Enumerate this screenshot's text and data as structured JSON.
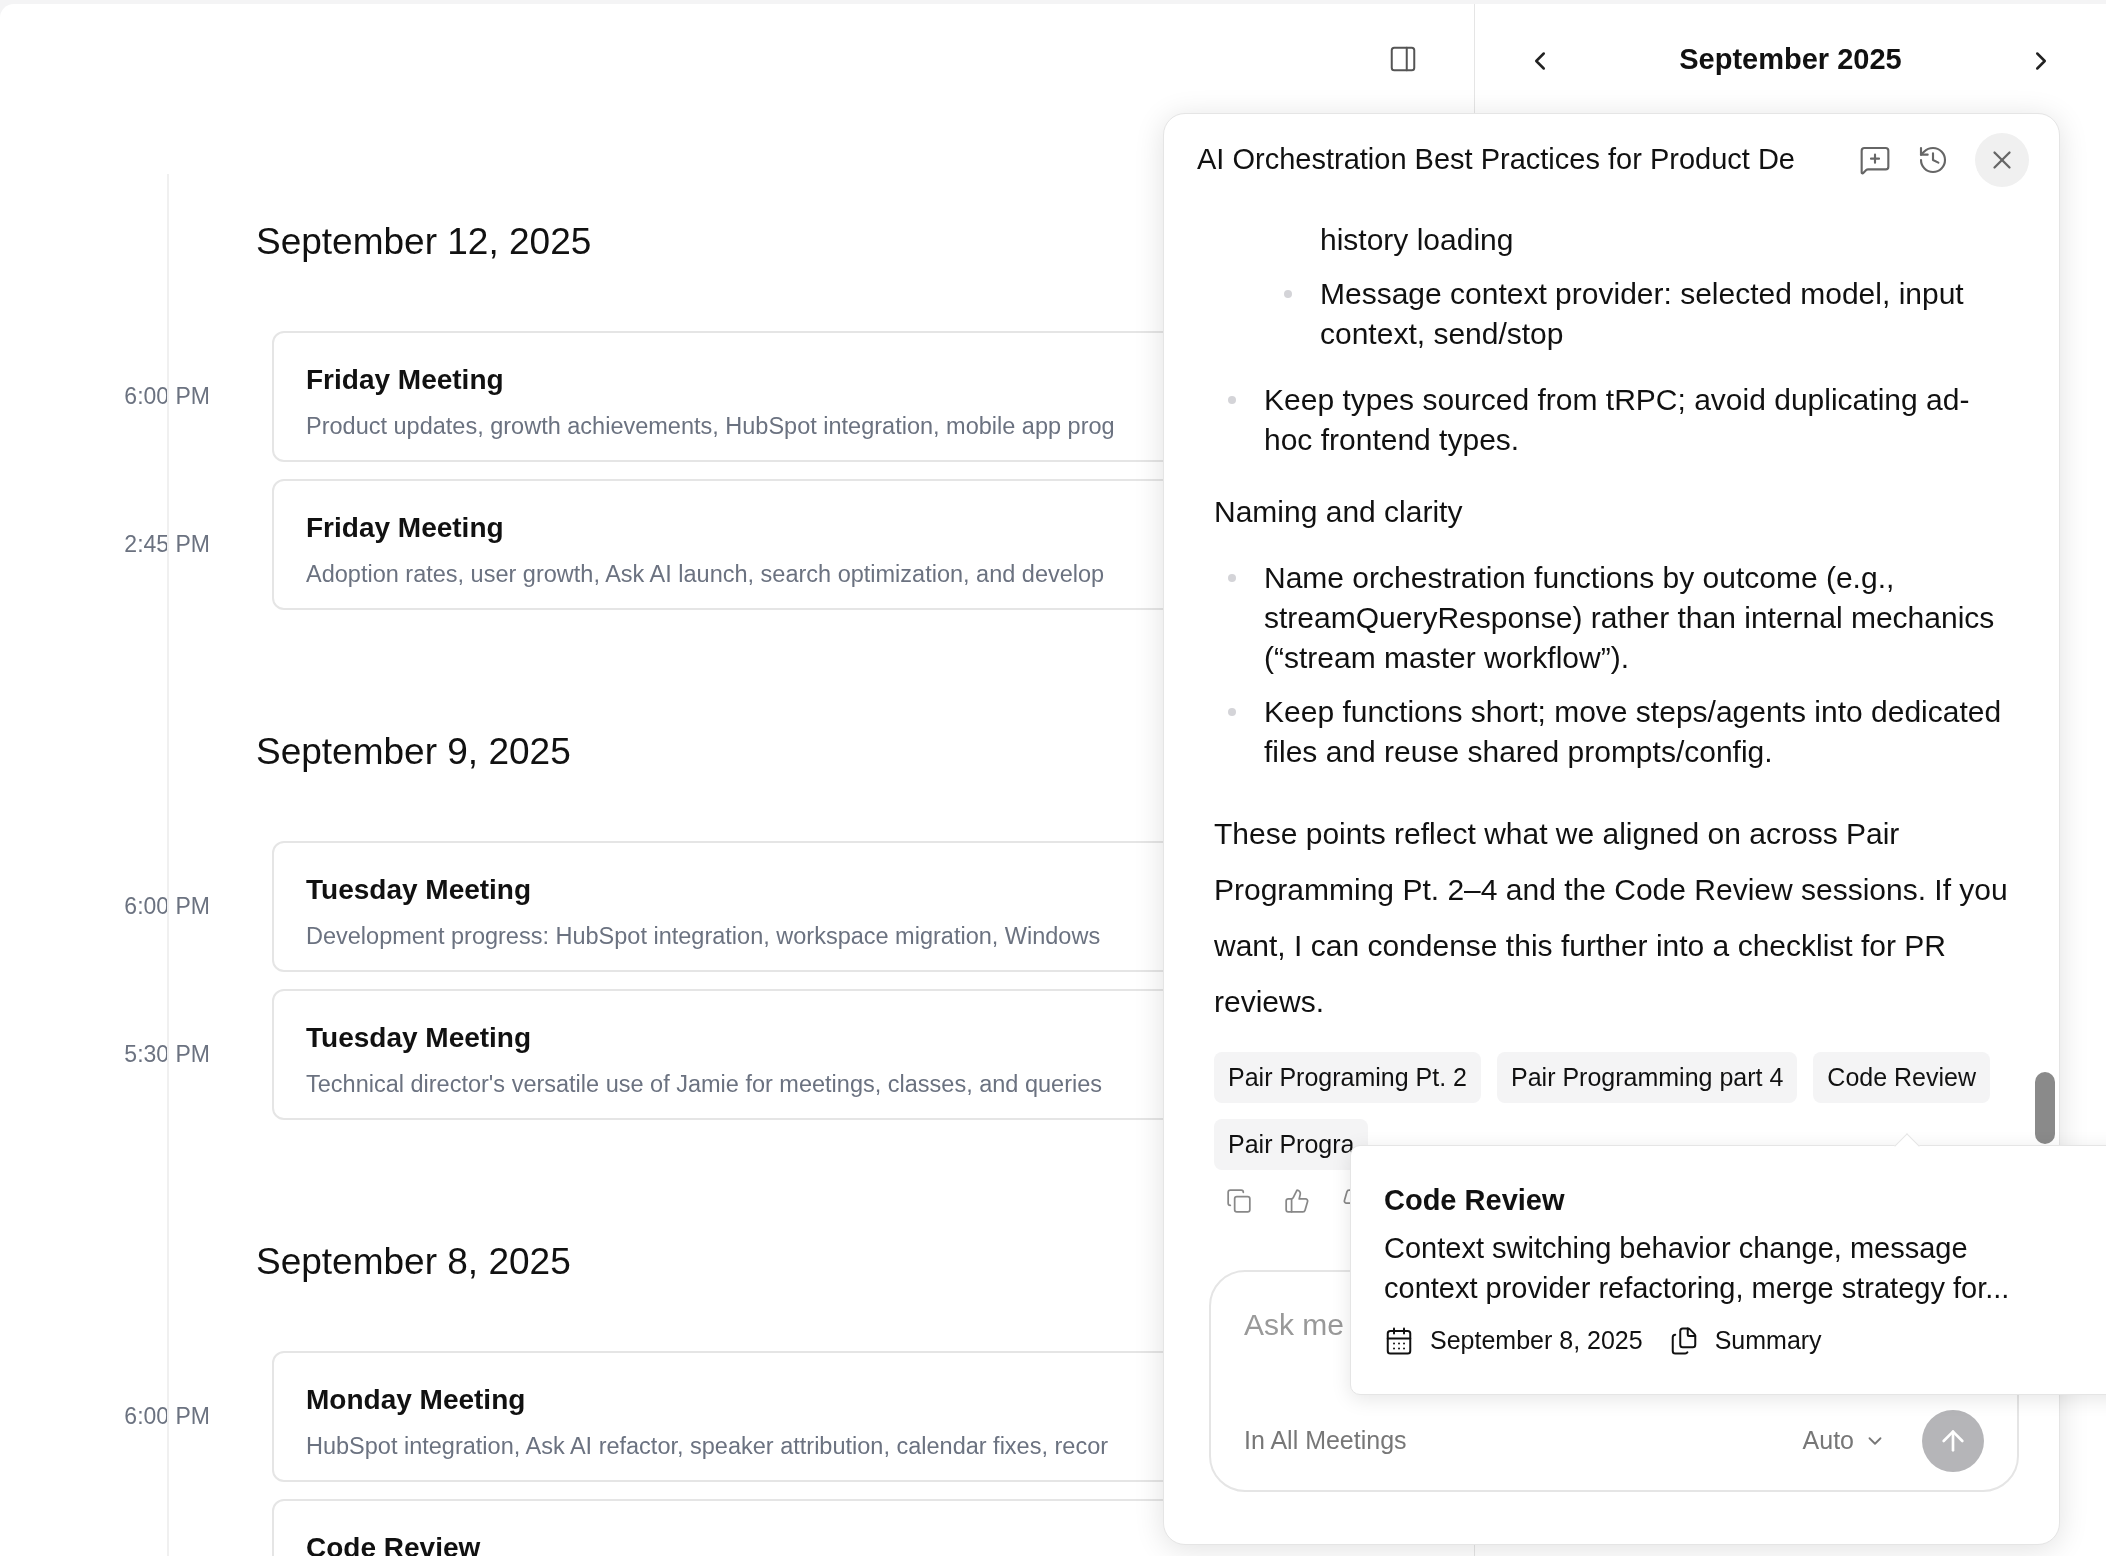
{
  "header": {
    "month": "September 2025"
  },
  "days": [
    {
      "date": "September 12, 2025",
      "meetings": [
        {
          "time": "6:00 PM",
          "title": "Friday Meeting",
          "summary": "Product updates, growth achievements, HubSpot integration, mobile app prog"
        },
        {
          "time": "2:45 PM",
          "title": "Friday Meeting",
          "summary": "Adoption rates, user growth, Ask AI launch, search optimization, and develop"
        }
      ]
    },
    {
      "date": "September 9, 2025",
      "meetings": [
        {
          "time": "6:00 PM",
          "title": "Tuesday Meeting",
          "summary": "Development progress: HubSpot integration, workspace migration, Windows"
        },
        {
          "time": "5:30 PM",
          "title": "Tuesday Meeting",
          "summary": "Technical director's versatile use of Jamie for meetings, classes, and queries"
        }
      ]
    },
    {
      "date": "September 8, 2025",
      "meetings": [
        {
          "time": "6:00 PM",
          "title": "Monday Meeting",
          "summary": "HubSpot integration, Ask AI refactor, speaker attribution, calendar fixes, recor"
        },
        {
          "title": "Code Review"
        }
      ]
    }
  ],
  "chat": {
    "title": "AI Orchestration Best Practices for Product De",
    "blocks": [
      {
        "kind": "sublist",
        "items": [
          {
            "text": "history loading",
            "bullet": false
          },
          {
            "text": "Message context provider: selected model, input context, send/stop",
            "bullet": true
          }
        ]
      },
      {
        "kind": "list",
        "items": [
          {
            "text": "Keep types sourced from tRPC; avoid duplicating ad-hoc frontend types.",
            "bullet": true
          }
        ]
      },
      {
        "kind": "heading",
        "text": "Naming and clarity"
      },
      {
        "kind": "list",
        "items": [
          {
            "text": "Name orchestration functions by outcome (e.g., streamQueryResponse) rather than internal mechanics (“stream master workflow”).",
            "bullet": true
          },
          {
            "text": "Keep functions short; move steps/agents into dedicated files and reuse shared prompts/config.",
            "bullet": true
          }
        ]
      },
      {
        "kind": "paragraph",
        "text": "These points reflect what we aligned on across Pair Programming Pt. 2–4 and the Code Review sessions. If you want, I can condense this further into a checklist for PR reviews."
      }
    ],
    "sources": [
      {
        "label": "Pair Programing Pt. 2"
      },
      {
        "label": "Pair Programming part 4"
      },
      {
        "label": "Code Review"
      },
      {
        "label": "Pair Progra"
      }
    ],
    "input": {
      "placeholder": "Ask me",
      "scope": "In All Meetings",
      "model": "Auto",
      "send_disabled": true
    }
  },
  "tooltip": {
    "title": "Code Review",
    "summary": "Context switching behavior change, message context provider refactoring, merge strategy for...",
    "date": "September 8, 2025",
    "link": "Summary"
  }
}
